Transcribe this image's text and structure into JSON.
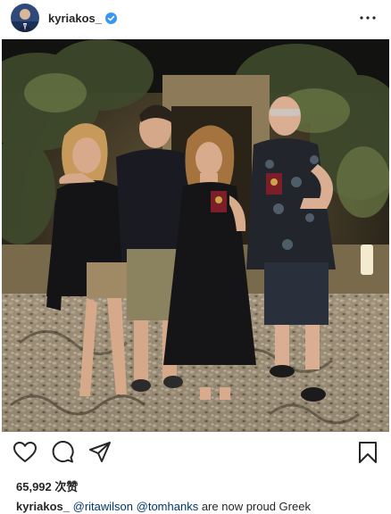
{
  "post": {
    "username": "kyriakos_",
    "verified": true,
    "likes_text": "65,992 次赞",
    "caption": {
      "username": "kyriakos_",
      "mention_1": "@ritawilson",
      "mention_2": "@tomhanks",
      "text": "are now proud Greek"
    }
  },
  "icons": {
    "avatar": "avatar",
    "verified": "verified-badge-icon",
    "more": "more-options-icon",
    "like": "heart-icon",
    "comment": "comment-icon",
    "share": "send-icon",
    "save": "bookmark-icon"
  },
  "colors": {
    "verified_blue": "#3897f0",
    "mention_blue": "#00376b",
    "text": "#262626"
  }
}
